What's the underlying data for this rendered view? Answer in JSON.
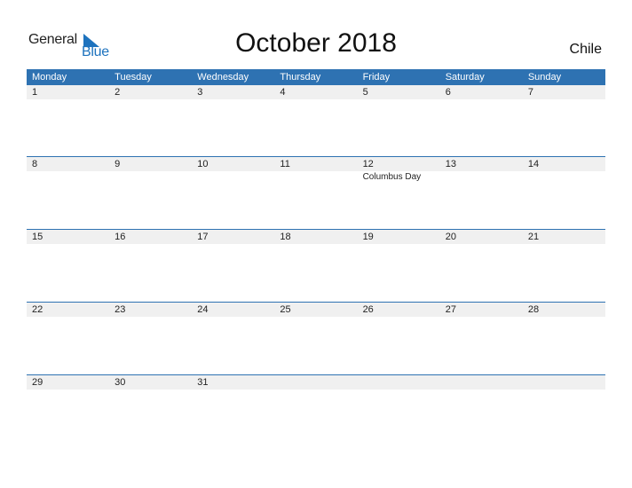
{
  "logo": {
    "word1": "General",
    "word2": "Blue"
  },
  "title": "October 2018",
  "country": "Chile",
  "colors": {
    "header_bg": "#2e72b2",
    "day_row_bg": "#f0f0f0",
    "brand_blue": "#1e73be"
  },
  "weekdays": [
    "Monday",
    "Tuesday",
    "Wednesday",
    "Thursday",
    "Friday",
    "Saturday",
    "Sunday"
  ],
  "weeks": [
    {
      "days": [
        "1",
        "2",
        "3",
        "4",
        "5",
        "6",
        "7"
      ],
      "events": [
        "",
        "",
        "",
        "",
        "",
        "",
        ""
      ]
    },
    {
      "days": [
        "8",
        "9",
        "10",
        "11",
        "12",
        "13",
        "14"
      ],
      "events": [
        "",
        "",
        "",
        "",
        "Columbus Day",
        "",
        ""
      ]
    },
    {
      "days": [
        "15",
        "16",
        "17",
        "18",
        "19",
        "20",
        "21"
      ],
      "events": [
        "",
        "",
        "",
        "",
        "",
        "",
        ""
      ]
    },
    {
      "days": [
        "22",
        "23",
        "24",
        "25",
        "26",
        "27",
        "28"
      ],
      "events": [
        "",
        "",
        "",
        "",
        "",
        "",
        ""
      ]
    },
    {
      "days": [
        "29",
        "30",
        "31",
        "",
        "",
        "",
        ""
      ],
      "events": [
        "",
        "",
        "",
        "",
        "",
        "",
        ""
      ]
    }
  ]
}
